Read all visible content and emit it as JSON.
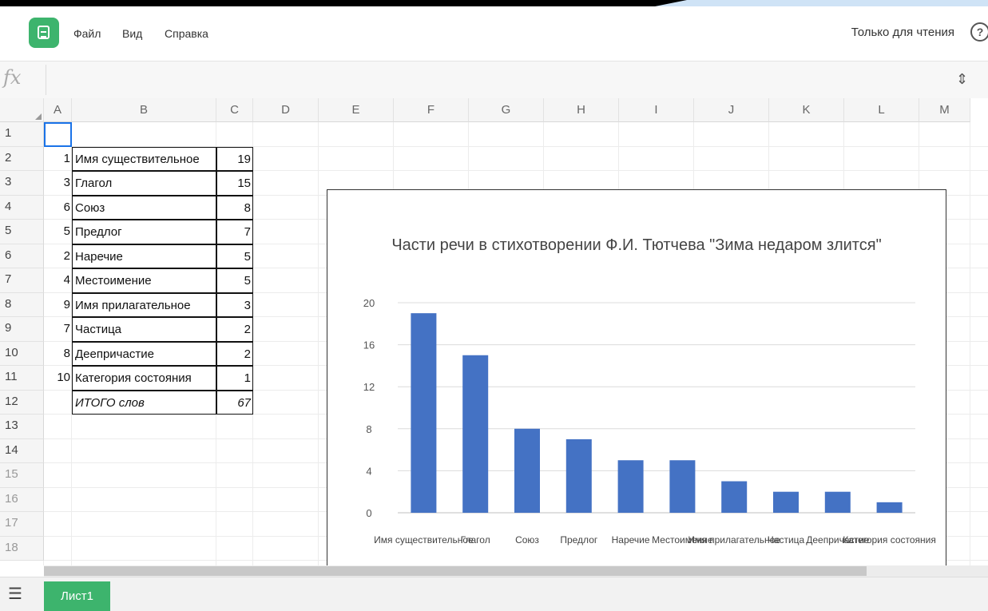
{
  "app": {
    "icon": "spreadsheet-app-icon",
    "accent": "#3db46d"
  },
  "menu": {
    "items": [
      "Файл",
      "Вид",
      "Справка"
    ],
    "readonly": "Только для чтения",
    "help_icon": "help-icon"
  },
  "formula": {
    "fx_label": "fx",
    "value": ""
  },
  "columns": [
    "A",
    "B",
    "C",
    "D",
    "E",
    "F",
    "G",
    "H",
    "I",
    "J",
    "K",
    "L",
    "M"
  ],
  "rows": [
    "1",
    "2",
    "3",
    "4",
    "5",
    "6",
    "7",
    "8",
    "9",
    "10",
    "11",
    "12",
    "13",
    "14",
    "15",
    "16",
    "17",
    "18"
  ],
  "table": [
    {
      "a": "1",
      "b": "Имя существительное",
      "c": "19"
    },
    {
      "a": "3",
      "b": "Глагол",
      "c": "15"
    },
    {
      "a": "6",
      "b": "Союз",
      "c": "8"
    },
    {
      "a": "5",
      "b": "Предлог",
      "c": "7"
    },
    {
      "a": "2",
      "b": "Наречие",
      "c": "5"
    },
    {
      "a": "4",
      "b": "Местоимение",
      "c": "5"
    },
    {
      "a": "9",
      "b": "Имя прилагательное",
      "c": "3"
    },
    {
      "a": "7",
      "b": "Частица",
      "c": "2"
    },
    {
      "a": "8",
      "b": "Деепричастие",
      "c": "2"
    },
    {
      "a": "10",
      "b": "Категория состояния",
      "c": "1"
    }
  ],
  "total": {
    "label": "ИТОГО слов",
    "value": "67"
  },
  "chart_data": {
    "type": "bar",
    "title": "Части речи в стихотворении Ф.И. Тютчева \"Зима недаром злится\"",
    "categories": [
      "Имя существительное",
      "Глагол",
      "Союз",
      "Предлог",
      "Наречие",
      "Местоимение",
      "Имя прилагательное",
      "Частица",
      "Деепричастие",
      "Категория состояния"
    ],
    "values": [
      19,
      15,
      8,
      7,
      5,
      5,
      3,
      2,
      2,
      1
    ],
    "ylim": [
      0,
      20
    ],
    "yticks": [
      "0",
      "4",
      "8",
      "12",
      "16",
      "20"
    ],
    "xlabel": "",
    "ylabel": "",
    "bar_color": "#4472c4",
    "grid": true
  },
  "sheets": {
    "active": "Лист1"
  }
}
